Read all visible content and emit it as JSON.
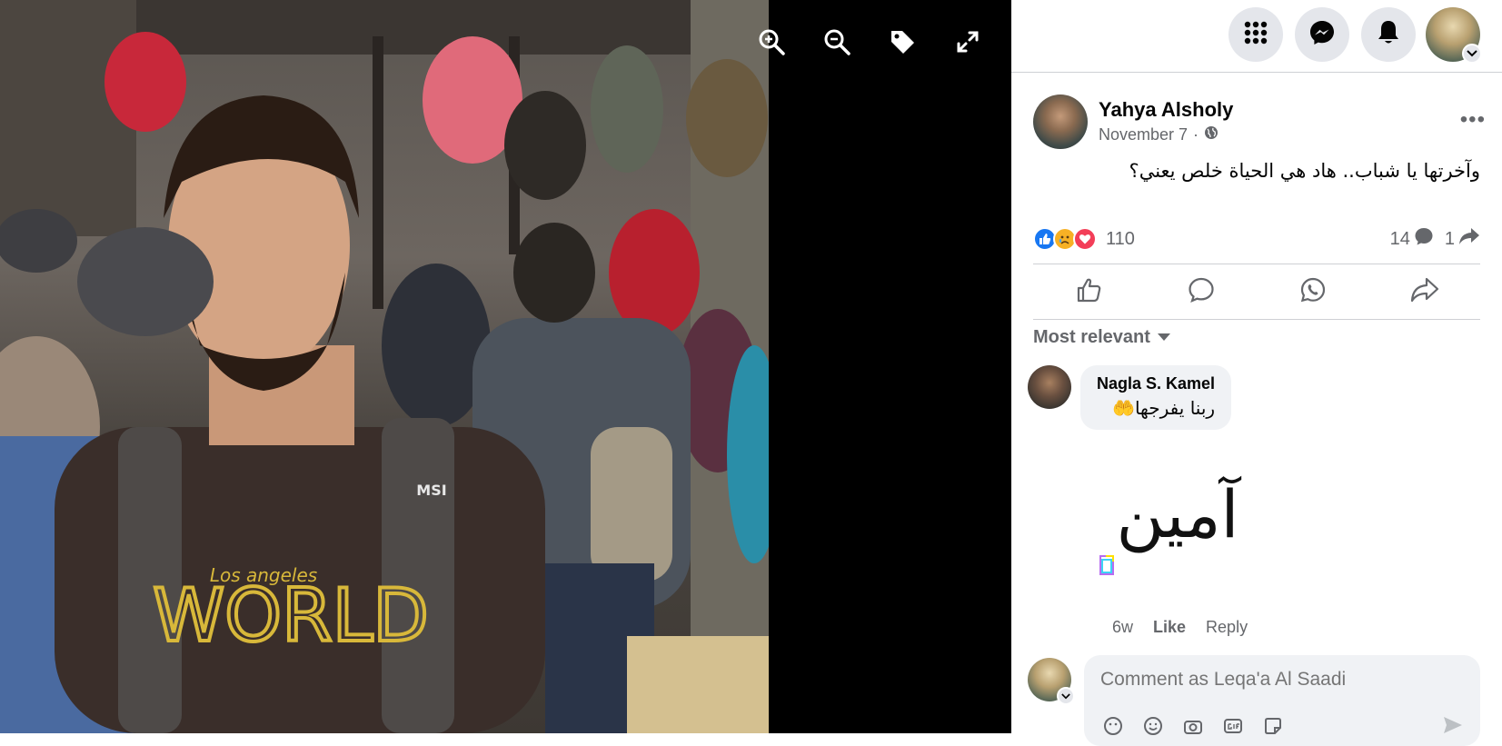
{
  "viewer": {
    "tools": [
      {
        "name": "zoom-in-icon"
      },
      {
        "name": "zoom-out-icon"
      },
      {
        "name": "tag-icon"
      },
      {
        "name": "fullscreen-icon"
      }
    ]
  },
  "topbar": {
    "buttons": [
      "menu-grid-icon",
      "messenger-icon",
      "notifications-bell-icon"
    ]
  },
  "post": {
    "author": "Yahya Alsholy",
    "date": "November 7",
    "date_separator": "·",
    "text": "وآخرتها يا شباب.. هاد هي الحياة خلص يعني؟",
    "reactions_count": "110",
    "comments_count": "14",
    "shares_count": "1"
  },
  "comments": {
    "sort_label": "Most relevant",
    "items": [
      {
        "name": "Nagla S. Kamel",
        "text": "ربنا يفرجها🤲",
        "gif_text": "آمين",
        "time": "6w",
        "like_label": "Like",
        "reply_label": "Reply"
      }
    ]
  },
  "composer": {
    "placeholder": "Comment as Leqa'a Al Saadi"
  },
  "colors": {
    "brand_blue": "#0866ff",
    "like_blue": "#1877f2",
    "love_red": "#f33e58",
    "sad_yellow": "#f7b125",
    "muted_text": "#65676b",
    "bubble_bg": "#f0f2f5"
  }
}
